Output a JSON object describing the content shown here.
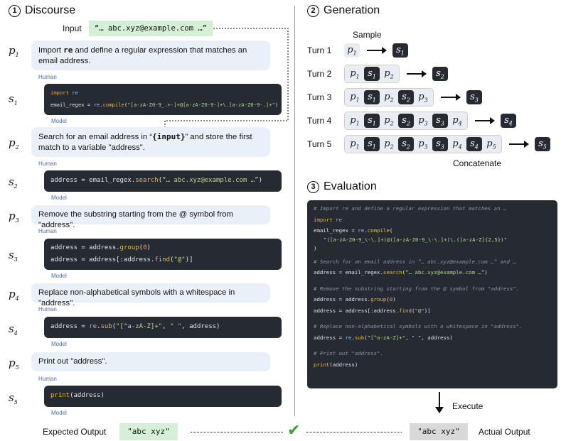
{
  "discourse": {
    "num": "1",
    "title": "Discourse",
    "input_label": "Input",
    "input_value": "“… abc.xyz@example.com …”",
    "human_tag": "Human",
    "model_tag": "Model",
    "turns": [
      {
        "p": "p",
        "pn": "1",
        "s": "s",
        "sn": "1",
        "prompt_a": "Import ",
        "prompt_b": "re",
        "prompt_c": " and define a regular expression that matches an email address."
      },
      {
        "p": "p",
        "pn": "2",
        "s": "s",
        "sn": "2",
        "prompt_a": "Search for an email address in “",
        "prompt_b": "{input}",
        "prompt_c": "” and store the first match to a variable \"address\"."
      },
      {
        "p": "p",
        "pn": "3",
        "s": "s",
        "sn": "3",
        "prompt_a": "Remove the substring starting from the @ symbol from \"address\".",
        "prompt_b": "",
        "prompt_c": ""
      },
      {
        "p": "p",
        "pn": "4",
        "s": "s",
        "sn": "4",
        "prompt_a": "Replace non-alphabetical symbols with a whitespace in \"address\".",
        "prompt_b": "",
        "prompt_c": ""
      },
      {
        "p": "p",
        "pn": "5",
        "s": "s",
        "sn": "5",
        "prompt_a": "Print out \"address\".",
        "prompt_b": "",
        "prompt_c": ""
      }
    ],
    "code": {
      "s1_l1_kw": "import",
      "s1_l1_mod": " re",
      "s1_l2_a": "email_regex = ",
      "s1_l2_mod": "re",
      "s1_l2_b": ".",
      "s1_l2_fn": "compile",
      "s1_l2_c": "(",
      "s1_l2_str": "\"[a-zA-Z0-9_.+-]+@[a-zA-Z0-9-]+\\.[a-zA-Z0-9-.]+\"",
      "s1_l2_d": ")",
      "s2_a": "address = email_regex.",
      "s2_fn": "search",
      "s2_b": "(",
      "s2_str": "“… abc.xyz@example.com …”",
      "s2_c": ")",
      "s3_l1_a": "address = address.",
      "s3_l1_fn": "group",
      "s3_l1_b": "(",
      "s3_l1_num": "0",
      "s3_l1_c": ")",
      "s3_l2_a": "address = address[:address.",
      "s3_l2_fn": "find",
      "s3_l2_b": "(",
      "s3_l2_str": "\"@\"",
      "s3_l2_c": ")]",
      "s4_a": "address = ",
      "s4_mod": "re",
      "s4_b": ".",
      "s4_fn": "sub",
      "s4_c": "(",
      "s4_str1": "\"[^a-zA-Z]+\"",
      "s4_d": ", ",
      "s4_str2": "\" \"",
      "s4_e": ", address)",
      "s5_fn": "print",
      "s5_a": "(address)"
    }
  },
  "generation": {
    "num": "2",
    "title": "Generation",
    "sample_label": "Sample",
    "concatenate_label": "Concatenate",
    "turn_labels": [
      "Turn 1",
      "Turn 2",
      "Turn 3",
      "Turn 4",
      "Turn 5"
    ]
  },
  "evaluation": {
    "num": "3",
    "title": "Evaluation",
    "comments": [
      "# Import re and define a regular expression that matches an …",
      "# Search for an email address in “… abc.xyz@example.com …” and …",
      "# Remove the substring starting from the @ symbol from \"address\".",
      "# Replace non-alphabetical symbols with a whitespace in \"address\".",
      "# Print out \"address\"."
    ],
    "compile_str": "\"([a-zA-Z0-9_\\-\\.]+)@([a-zA-Z0-9_\\-\\.]+)\\.([a-zA-Z]{2,5})\"",
    "execute_label": "Execute"
  },
  "output": {
    "expected_label": "Expected Output",
    "expected_value": "\"abc xyz\"",
    "actual_value": "\"abc xyz\"",
    "actual_label": "Actual Output",
    "check_mark": "✔"
  },
  "colors": {
    "code_bg": "#262b33",
    "bubble_bg": "#eaf0f8",
    "green_box": "#d5f0d6",
    "gray_box": "#d9d9d9",
    "check": "#3aa535"
  }
}
